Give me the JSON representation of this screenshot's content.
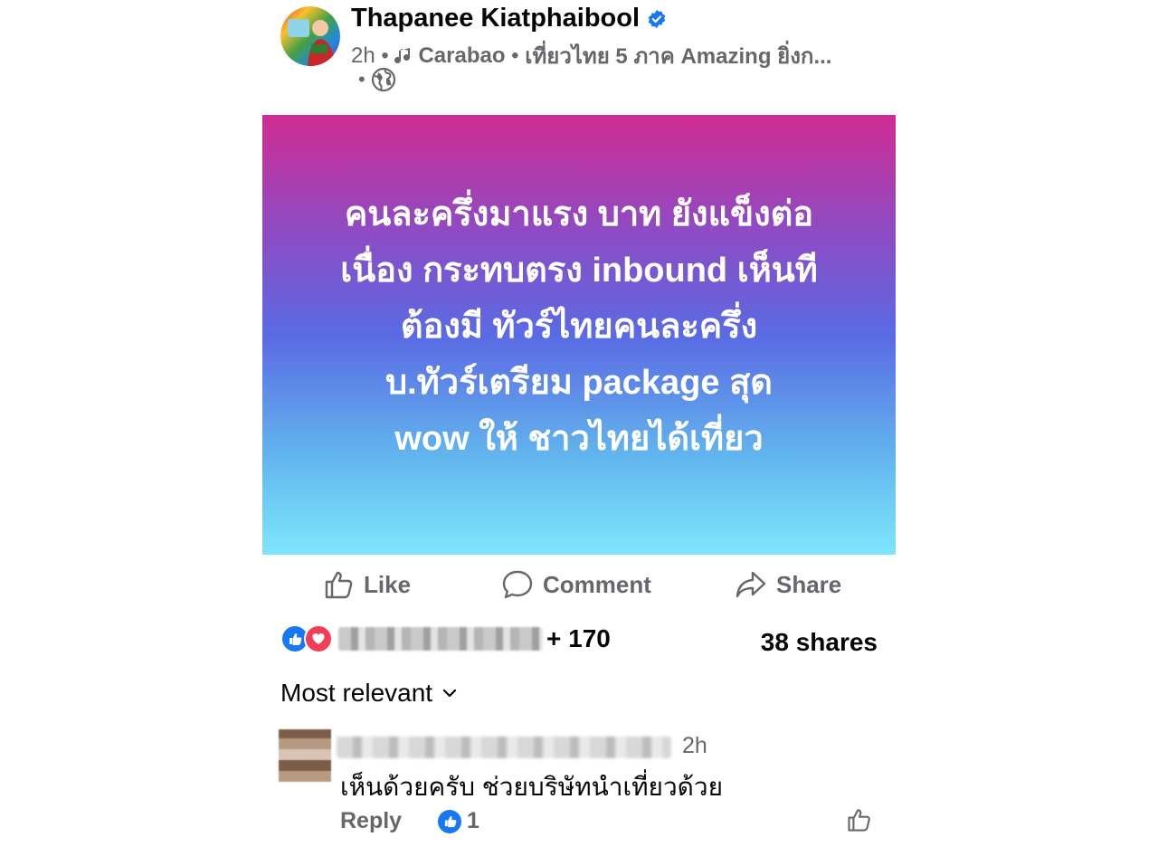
{
  "post": {
    "author": "Thapanee Kiatphaibool",
    "time": "2h",
    "music_artist": "Carabao",
    "music_song": "เที่ยวไทย 5 ภาค Amazing ยิ่งก...",
    "body_lines": [
      "คนละครึ่งมาแรง บาท ยังแข็งต่อ",
      "เนื่อง กระทบตรง inbound เห็นที",
      "ต้องมี ทัวร์ไทยคนละครึ่ง",
      "บ.ทัวร์เตรียม package สุด",
      "wow ให้ ชาวไทยได้เที่ยว"
    ],
    "background_gradient": [
      "#d12c94",
      "#5a6ae3",
      "#7fe6fc"
    ]
  },
  "actions": {
    "like": "Like",
    "comment": "Comment",
    "share": "Share"
  },
  "reactions": {
    "count": "+ 170",
    "shares": "38 shares",
    "icons": [
      "like-icon",
      "love-icon"
    ]
  },
  "sort_label": "Most relevant",
  "comment": {
    "time": "2h",
    "text": "เห็นด้วยครับ ช่วยบริษัทนำเที่ยวด้วย",
    "reply_label": "Reply",
    "like_count": "1"
  },
  "colors": {
    "accent": "#1877f2",
    "love": "#f33e58",
    "secondary_text": "#65676b"
  }
}
